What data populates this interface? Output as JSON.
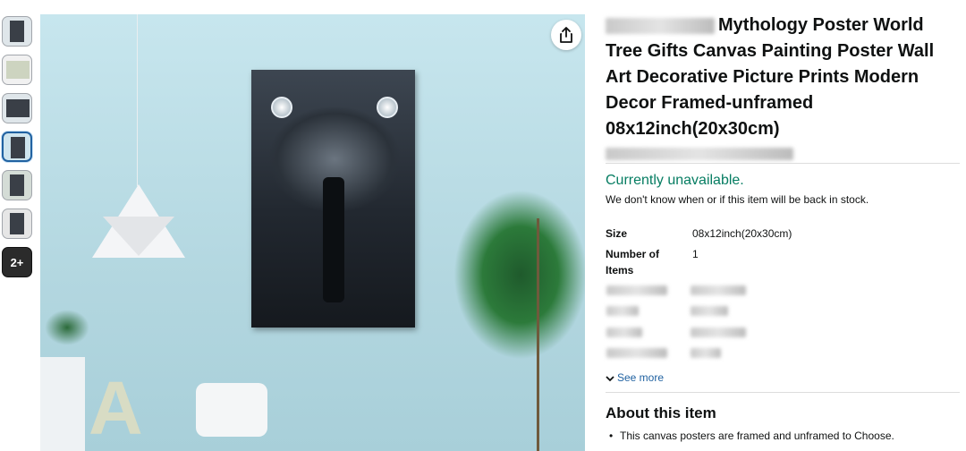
{
  "gallery": {
    "thumbnails": [
      "thumb-1",
      "thumb-2",
      "thumb-3",
      "thumb-4",
      "thumb-5",
      "thumb-6"
    ],
    "more_label": "2+",
    "selected_index": 3
  },
  "product": {
    "title_prefix_redacted": true,
    "title": "Mythology Poster World Tree Gifts Canvas Painting Poster Wall Art Decorative Picture Prints Modern Decor Framed-unframed 08x12inch(20x30cm)"
  },
  "availability": {
    "status": "Currently unavailable.",
    "note": "We don't know when or if this item will be back in stock."
  },
  "specs": [
    {
      "label": "Size",
      "value": "08x12inch(20x30cm)"
    },
    {
      "label": "Number of Items",
      "value": "1"
    }
  ],
  "see_more": "See more",
  "about": {
    "heading": "About this item",
    "bullets": [
      "This canvas posters are framed and unframed to Choose."
    ]
  },
  "colors": {
    "available_green": "#067d62",
    "link_blue": "#2162a1"
  },
  "icons": [
    "share-icon",
    "chevron-down-icon"
  ]
}
